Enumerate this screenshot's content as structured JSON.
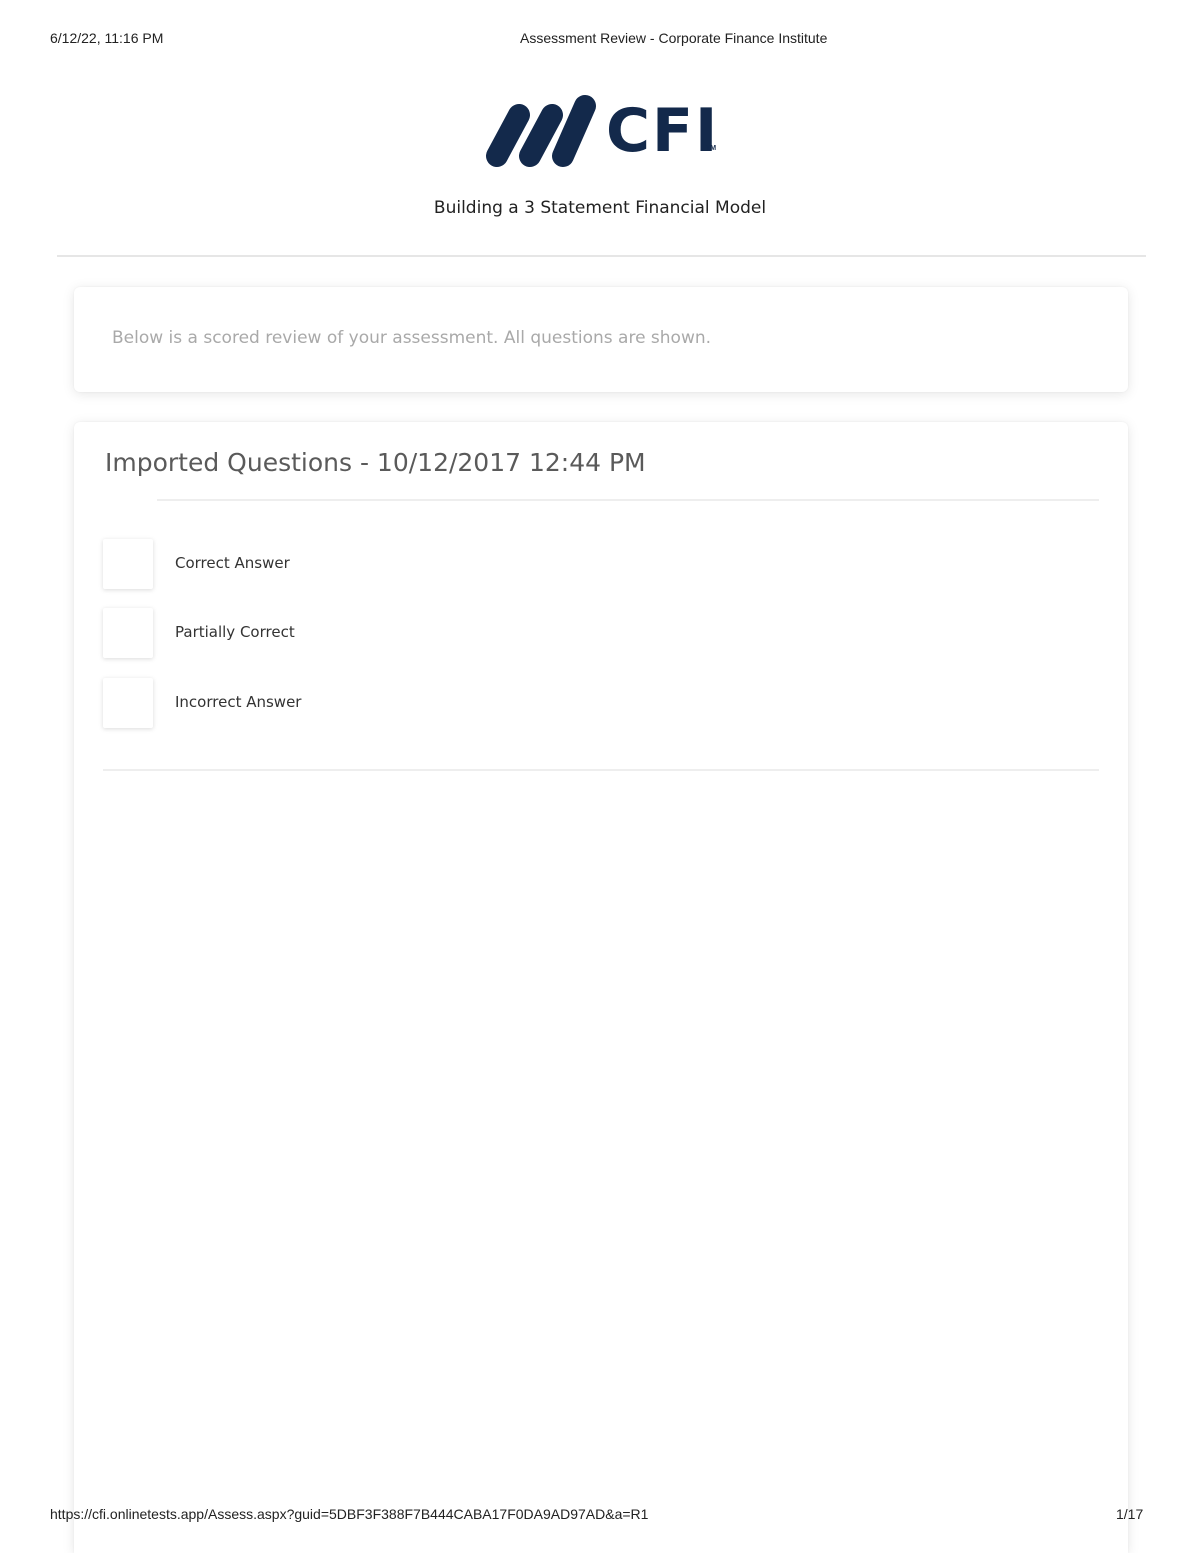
{
  "print_header": {
    "date": "6/12/22, 11:16 PM",
    "title": "Assessment Review - Corporate Finance Institute"
  },
  "logo": {
    "text": "CFI",
    "tm": "TM",
    "color": "#13294b"
  },
  "course_title": "Building a 3 Statement Financial Model",
  "intro": {
    "text": "Below is a scored review of your assessment. All questions are shown."
  },
  "section": {
    "title": "Imported Questions - 10/12/2017 12:44 PM",
    "legend": [
      {
        "label": "Correct Answer"
      },
      {
        "label": "Partially Correct"
      },
      {
        "label": "Incorrect Answer"
      }
    ]
  },
  "print_footer": {
    "url": "https://cfi.onlinetests.app/Assess.aspx?guid=5DBF3F388F7B444CABA17F0DA9AD97AD&a=R1",
    "page": "1/17"
  }
}
